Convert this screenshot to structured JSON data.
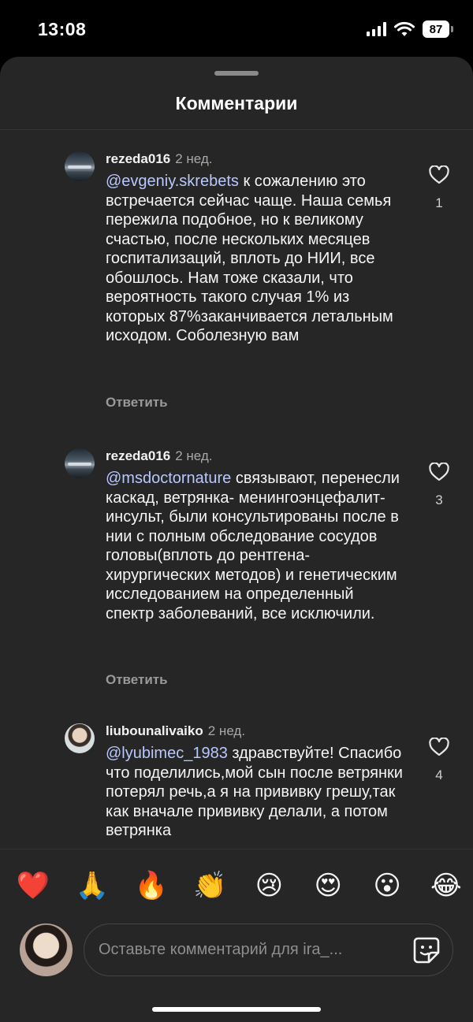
{
  "status_bar": {
    "time": "13:08",
    "battery": "87"
  },
  "header": {
    "title": "Комментарии"
  },
  "comments": [
    {
      "username": "rezeda016",
      "time": "2 нед.",
      "mention": "@evgeniy.skrebets",
      "text": " к сожалению это встречается сейчас чаще. Наша семья пережила подобное, но  к великому счастью, после нескольких месяцев госпитализаций, вплоть до НИИ, все обошлось. Нам тоже сказали, что вероятность такого случая 1% из которых 87%заканчивается летальным исходом. Соболезную вам",
      "reply_label": "Ответить",
      "likes": "1"
    },
    {
      "username": "rezeda016",
      "time": "2 нед.",
      "mention": "@msdoctornature",
      "text": " связывают, перенесли каскад, ветрянка- менингоэнцефалит- инсульт, были консультированы после в нии с полным обследование сосудов головы(вплоть до рентгена- хирургических методов) и генетическим исследованием на определенный спектр заболеваний, все исключили.",
      "reply_label": "Ответить",
      "likes": "3"
    },
    {
      "username": "liubounalivaiko",
      "time": "2 нед.",
      "mention": "@lyubimec_1983",
      "text": " здравствуйте! Спасибо что поделились,мой сын после ветрянки потерял речь,а я на прививку грешу,так как вначале прививку делали, а потом ветрянка",
      "likes": "4"
    }
  ],
  "reactions": [
    "❤️",
    "🙏",
    "🔥",
    "👏",
    "😢",
    "😍",
    "😮",
    "😂"
  ],
  "input": {
    "placeholder": "Оставьте комментарий для ira_..."
  },
  "icons": {
    "like": "heart-outline-icon",
    "sticker": "sticker-icon",
    "signal": "cellular-signal-icon",
    "wifi": "wifi-icon",
    "battery": "battery-icon"
  }
}
